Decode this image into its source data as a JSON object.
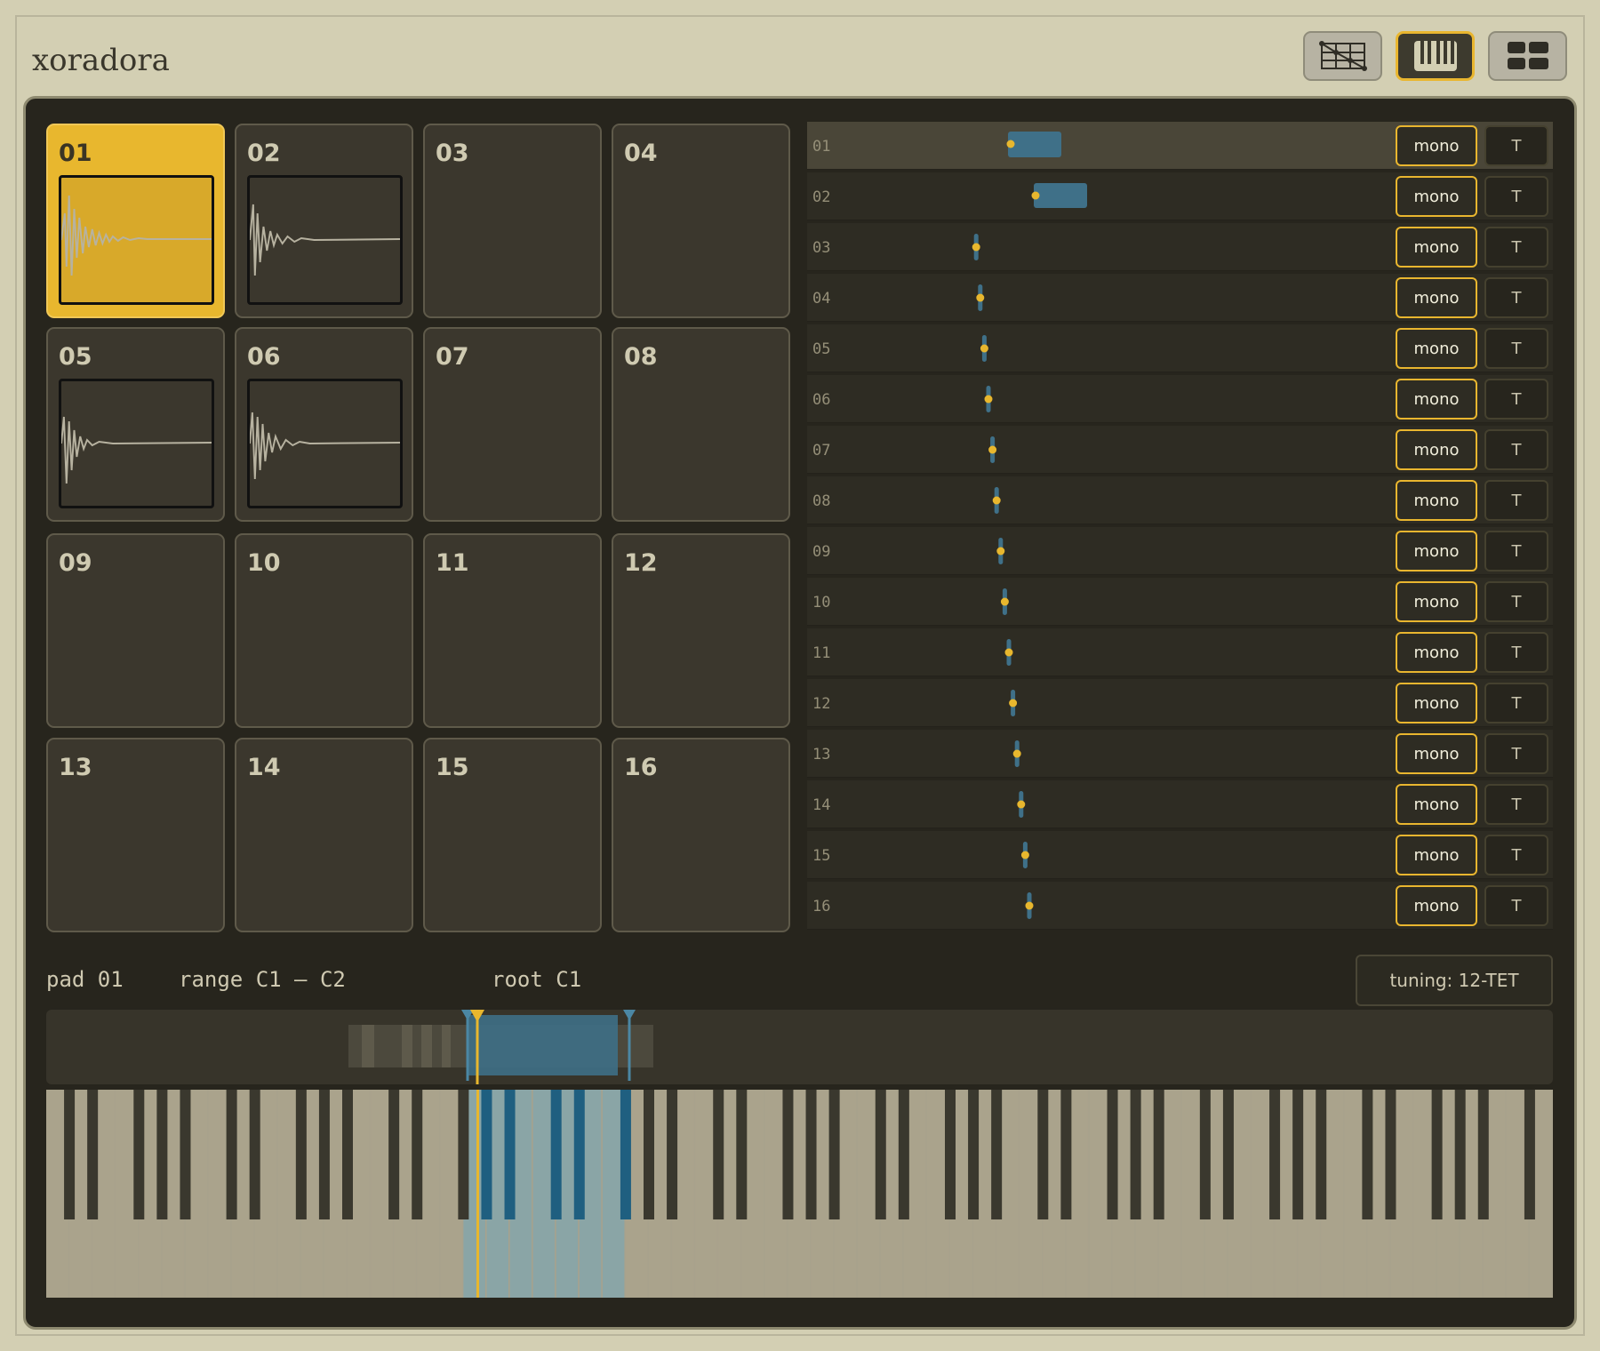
{
  "app": {
    "title": "xoradora"
  },
  "toolbar": {
    "views": [
      {
        "name": "grid-view-icon",
        "active": false
      },
      {
        "name": "keyboard-view-icon",
        "active": true
      },
      {
        "name": "pads-view-icon",
        "active": false
      }
    ]
  },
  "pads": [
    {
      "label": "01",
      "has_sample": true,
      "selected": true
    },
    {
      "label": "02",
      "has_sample": true,
      "selected": false
    },
    {
      "label": "03",
      "has_sample": false,
      "selected": false
    },
    {
      "label": "04",
      "has_sample": false,
      "selected": false
    },
    {
      "label": "05",
      "has_sample": true,
      "selected": false
    },
    {
      "label": "06",
      "has_sample": true,
      "selected": false
    },
    {
      "label": "07",
      "has_sample": false,
      "selected": false
    },
    {
      "label": "08",
      "has_sample": false,
      "selected": false
    },
    {
      "label": "09",
      "has_sample": false,
      "selected": false
    },
    {
      "label": "10",
      "has_sample": false,
      "selected": false
    },
    {
      "label": "11",
      "has_sample": false,
      "selected": false
    },
    {
      "label": "12",
      "has_sample": false,
      "selected": false
    },
    {
      "label": "13",
      "has_sample": false,
      "selected": false
    },
    {
      "label": "14",
      "has_sample": false,
      "selected": false
    },
    {
      "label": "15",
      "has_sample": false,
      "selected": false
    },
    {
      "label": "16",
      "has_sample": false,
      "selected": false
    }
  ],
  "rows": [
    {
      "label": "01",
      "mode": "mono",
      "toggle": "T",
      "selected": true
    },
    {
      "label": "02",
      "mode": "mono",
      "toggle": "T"
    },
    {
      "label": "03",
      "mode": "mono",
      "toggle": "T"
    },
    {
      "label": "04",
      "mode": "mono",
      "toggle": "T"
    },
    {
      "label": "05",
      "mode": "mono",
      "toggle": "T"
    },
    {
      "label": "06",
      "mode": "mono",
      "toggle": "T"
    },
    {
      "label": "07",
      "mode": "mono",
      "toggle": "T"
    },
    {
      "label": "08",
      "mode": "mono",
      "toggle": "T"
    },
    {
      "label": "09",
      "mode": "mono",
      "toggle": "T"
    },
    {
      "label": "10",
      "mode": "mono",
      "toggle": "T"
    },
    {
      "label": "11",
      "mode": "mono",
      "toggle": "T"
    },
    {
      "label": "12",
      "mode": "mono",
      "toggle": "T"
    },
    {
      "label": "13",
      "mode": "mono",
      "toggle": "T"
    },
    {
      "label": "14",
      "mode": "mono",
      "toggle": "T"
    },
    {
      "label": "15",
      "mode": "mono",
      "toggle": "T"
    },
    {
      "label": "16",
      "mode": "mono",
      "toggle": "T"
    }
  ],
  "status": {
    "pad": "pad 01",
    "range": "range C1 – C2",
    "root": "root C1",
    "tuning": "tuning: 12-TET"
  },
  "colors": {
    "accent": "#e8b72e",
    "range": "#3f7088",
    "panel": "#27251d"
  }
}
